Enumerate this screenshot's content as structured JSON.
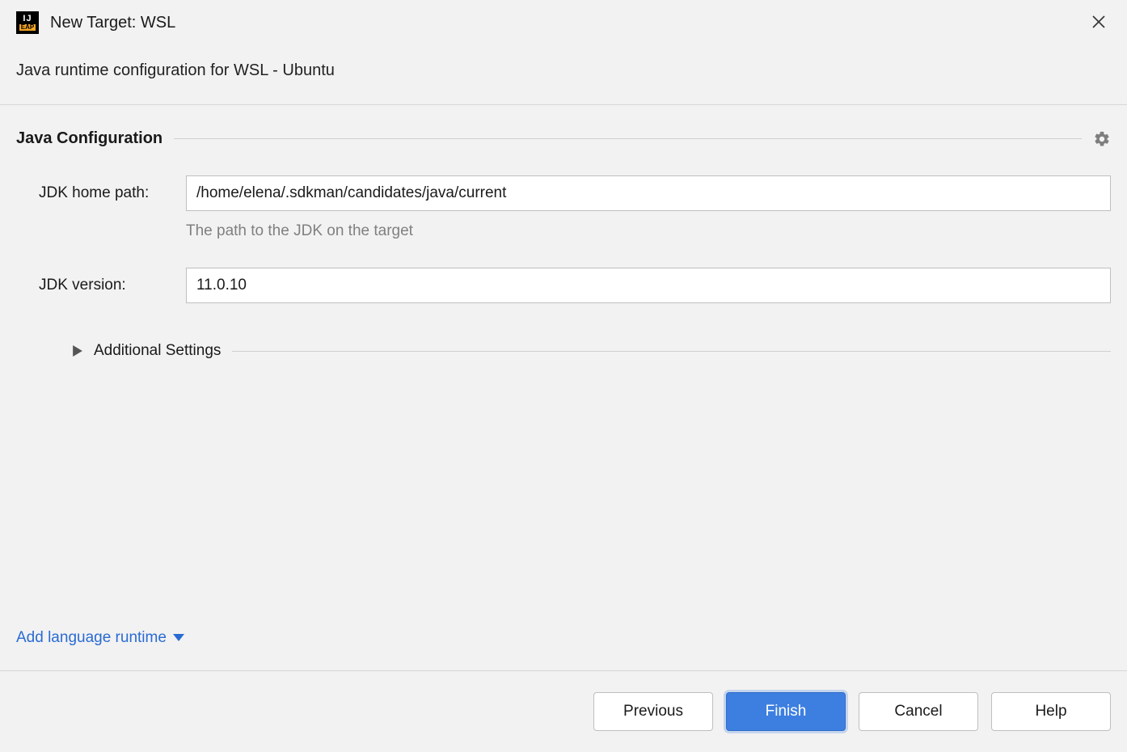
{
  "window": {
    "title": "New Target: WSL",
    "subtitle": "Java runtime configuration for WSL - Ubuntu"
  },
  "section": {
    "title": "Java Configuration"
  },
  "fields": {
    "jdk_home": {
      "label": "JDK home path:",
      "value": "/home/elena/.sdkman/candidates/java/current",
      "hint": "The path to the JDK on the target"
    },
    "jdk_version": {
      "label": "JDK version:",
      "value": "11.0.10"
    }
  },
  "collapsible": {
    "label": "Additional Settings"
  },
  "link": {
    "add_runtime": "Add language runtime"
  },
  "buttons": {
    "previous": "Previous",
    "finish": "Finish",
    "cancel": "Cancel",
    "help": "Help"
  }
}
